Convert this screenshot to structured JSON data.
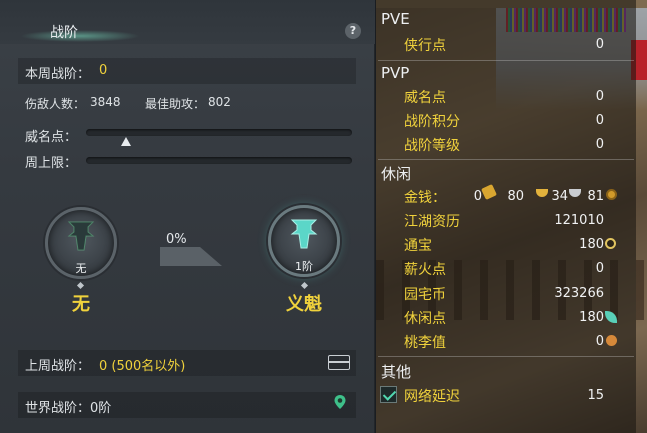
{
  "panel": {
    "title": "战阶",
    "help_label": "?",
    "weekly_rank_label": "本周战阶：",
    "weekly_rank_value": "0",
    "kills_label": "伤敌人数：",
    "kills_value": "3848",
    "best_assist_label": "最佳助攻：",
    "best_assist_value": "802",
    "prestige_label": "威名点：",
    "prestige_fill": 0.15,
    "weekly_cap_label": "周上限：",
    "weekly_cap_fill": 0,
    "current": {
      "small": "无",
      "big": "无"
    },
    "progress_pct": "0%",
    "next": {
      "small": "1阶",
      "big": "义魁"
    },
    "last_week_label": "上周战阶：",
    "last_week_value": "0 (500名以外)",
    "world_rank_text": "世界战阶：0阶"
  },
  "stats": {
    "pve": {
      "title": "PVE",
      "items": [
        {
          "label": "侠行点",
          "value": "0"
        }
      ]
    },
    "pvp": {
      "title": "PVP",
      "items": [
        {
          "label": "威名点",
          "value": "0"
        },
        {
          "label": "战阶积分",
          "value": "0"
        },
        {
          "label": "战阶等级",
          "value": "0"
        }
      ]
    },
    "leisure": {
      "title": "休闲",
      "gold": {
        "label": "金钱：",
        "gold": "0",
        "silver": "80",
        "copper": "34",
        "other": "81"
      },
      "items": [
        {
          "label": "江湖资历",
          "value": "121010"
        },
        {
          "label": "通宝",
          "value": "180"
        },
        {
          "label": "薪火点",
          "value": "0"
        },
        {
          "label": "园宅币",
          "value": "323266"
        },
        {
          "label": "休闲点",
          "value": "180"
        },
        {
          "label": "桃李值",
          "value": "0"
        }
      ]
    },
    "other": {
      "title": "其他",
      "latency_label": "网络延迟",
      "latency_value": "15"
    }
  },
  "colors": {
    "accent_yellow": "#f0d23c",
    "teal": "#52d8b0"
  },
  "icons": [
    "help-icon",
    "chest-icon",
    "location-pin-icon",
    "gold-coin-icon",
    "silver-ingot-icon",
    "copper-ingot-icon",
    "token-icon",
    "checkmark-icon"
  ]
}
